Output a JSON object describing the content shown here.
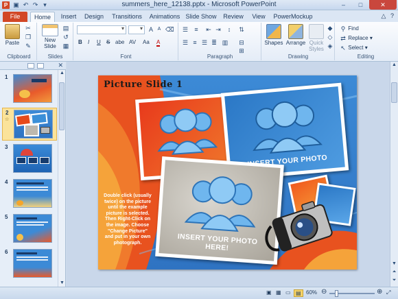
{
  "window": {
    "title": "summers_here_12138.pptx - Microsoft PowerPoint",
    "app_icon": "P",
    "minimize_icon": "–",
    "maximize_icon": "□",
    "close_icon": "✕"
  },
  "tabs": {
    "file": "File",
    "items": [
      "Home",
      "Insert",
      "Design",
      "Transitions",
      "Animations",
      "Slide Show",
      "Review",
      "View",
      "PowerMockup"
    ],
    "active": "Home"
  },
  "ribbon": {
    "clipboard": {
      "label": "Clipboard",
      "paste": "Paste"
    },
    "slides": {
      "label": "Slides",
      "new_slide": "New Slide",
      "new_slide_arrow": "▾"
    },
    "font": {
      "label": "Font",
      "bold": "B",
      "italic": "I",
      "underline": "U",
      "strike": "S",
      "shadow": "abe",
      "spacing": "AV",
      "case": "Aa",
      "color": "A"
    },
    "paragraph": {
      "label": "Paragraph"
    },
    "drawing": {
      "label": "Drawing",
      "shapes": "Shapes",
      "arrange": "Arrange",
      "quick_styles": "Quick Styles"
    },
    "editing": {
      "label": "Editing",
      "find": "Find",
      "replace": "Replace",
      "replace_arrow": "▾",
      "select": "Select",
      "select_arrow": "▾"
    }
  },
  "thumbnails": [
    {
      "num": "1",
      "star": ""
    },
    {
      "num": "2",
      "star": "☆"
    },
    {
      "num": "3",
      "star": ""
    },
    {
      "num": "4",
      "star": ""
    },
    {
      "num": "5",
      "star": ""
    },
    {
      "num": "6",
      "star": ""
    }
  ],
  "slide": {
    "title": "Picture Slide 1",
    "frame_text_1": "INSERT YOUR PHOTO",
    "frame_text_2": "INSERT YOUR PHOTO",
    "frame_text_3a": "INSERT YOUR PHOTO",
    "frame_text_3b": "HERE!",
    "instructions": "Double click (usually twice) on the picture until the example picture is selected. Then Right-Click on the image. Choose \"Change Picture\" and put in your own photograph."
  },
  "statusbar": {
    "zoom": "60%",
    "zoom_out": "⊖",
    "zoom_in": "⊕"
  },
  "colors": {
    "file_tab": "#d24726",
    "accent": "#2f73c2"
  }
}
